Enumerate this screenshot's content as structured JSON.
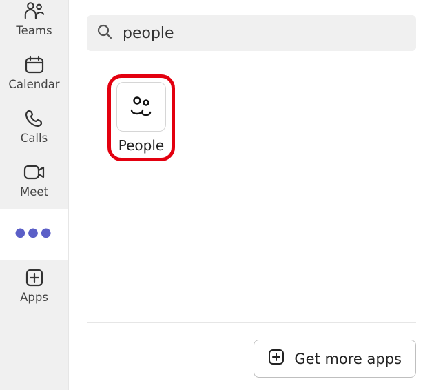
{
  "rail": {
    "items": [
      {
        "id": "teams",
        "label": "Teams",
        "icon": "teams"
      },
      {
        "id": "calendar",
        "label": "Calendar",
        "icon": "calendar"
      },
      {
        "id": "calls",
        "label": "Calls",
        "icon": "calls"
      },
      {
        "id": "meet",
        "label": "Meet",
        "icon": "meet"
      },
      {
        "id": "more",
        "label": "",
        "icon": "more"
      },
      {
        "id": "apps",
        "label": "Apps",
        "icon": "apps"
      }
    ]
  },
  "search": {
    "value": "people",
    "placeholder": "Search"
  },
  "results": [
    {
      "id": "people",
      "label": "People",
      "icon": "people"
    }
  ],
  "footer": {
    "get_more_label": "Get more apps"
  }
}
